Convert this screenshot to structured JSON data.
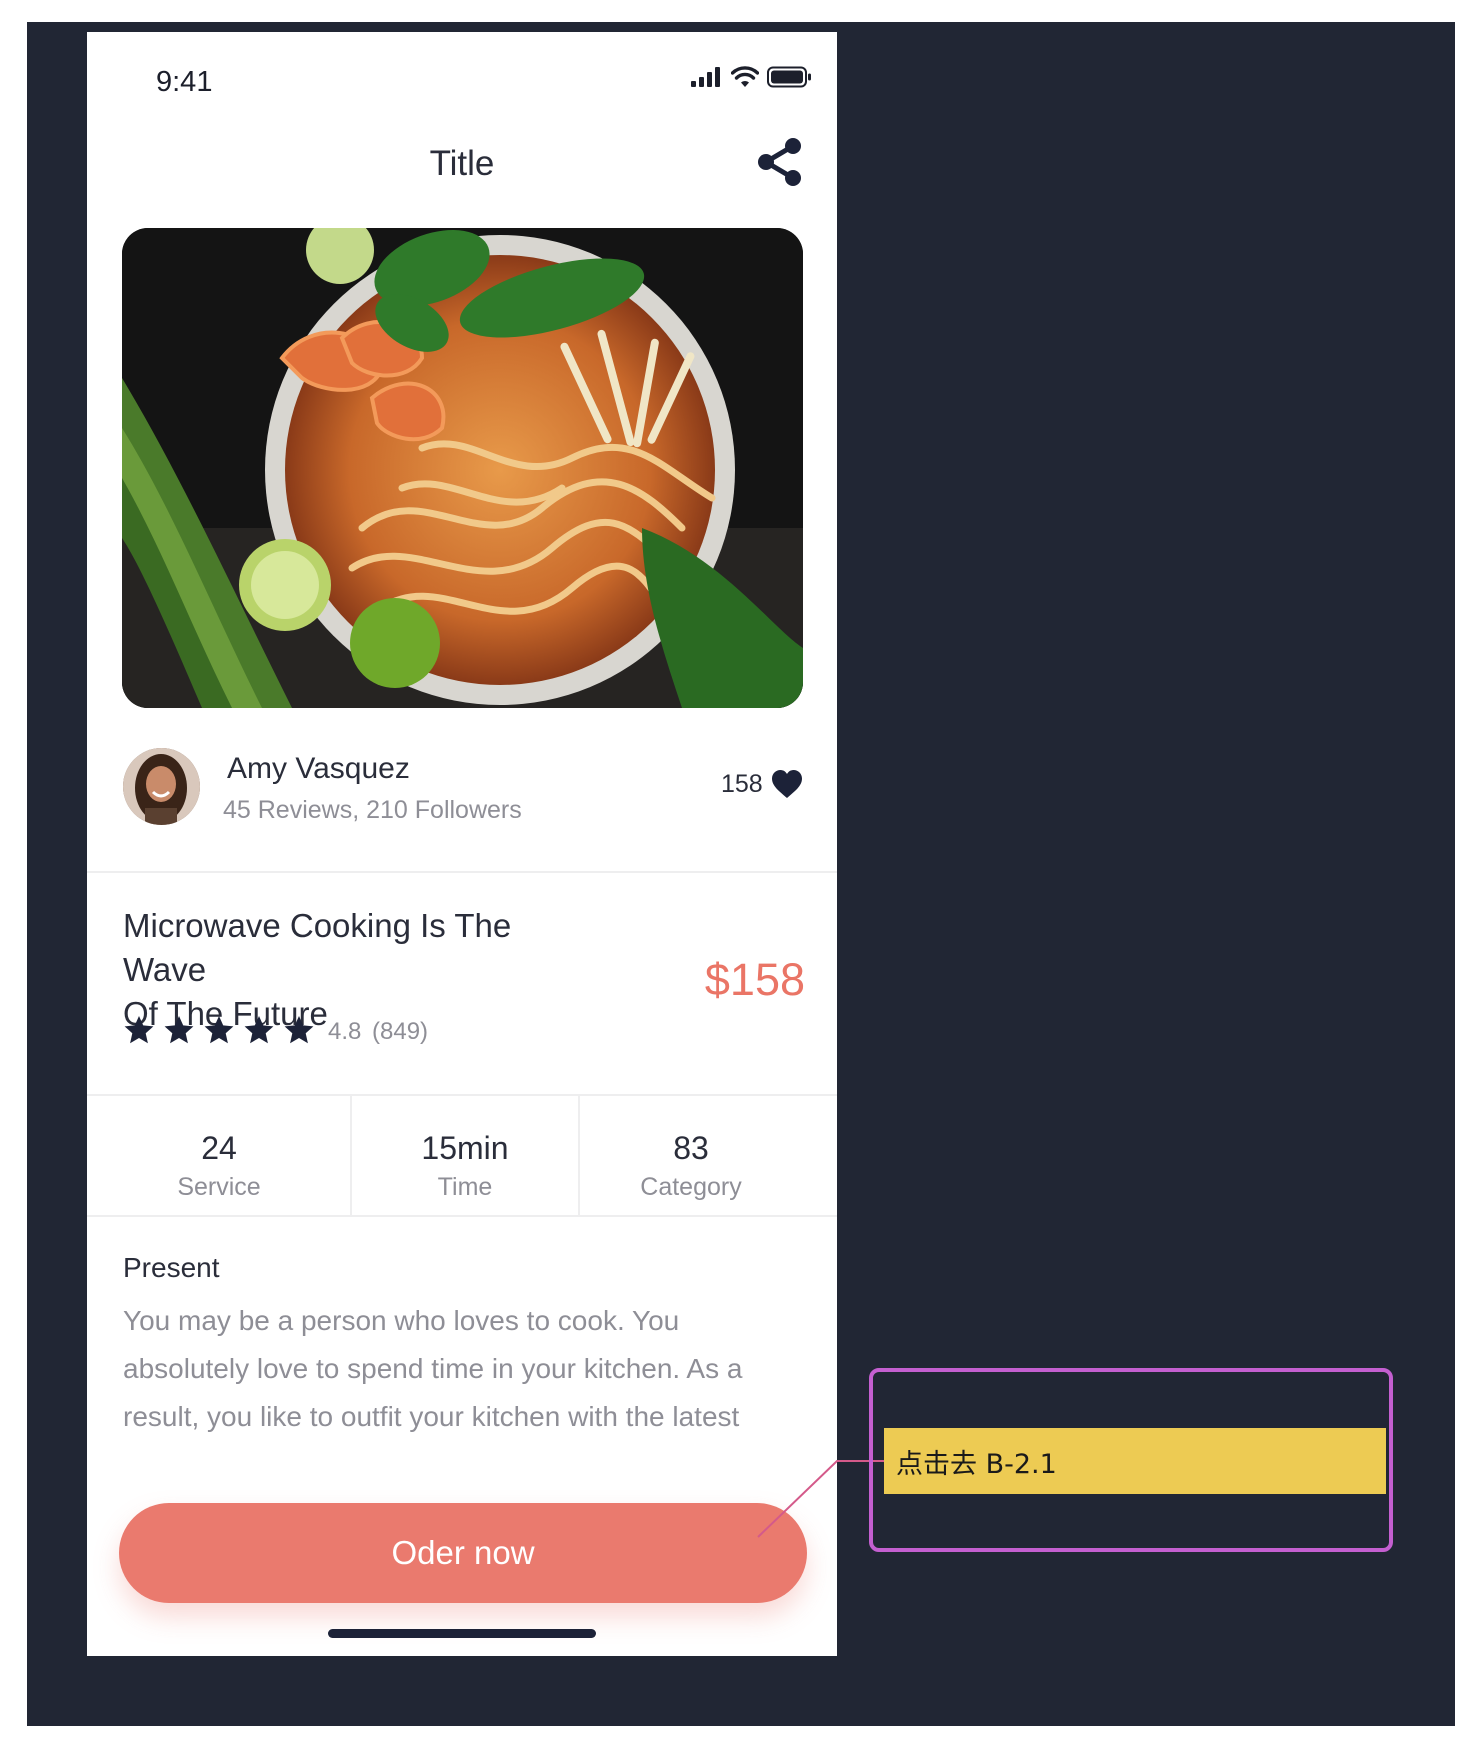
{
  "status_bar": {
    "time": "9:41"
  },
  "nav": {
    "title": "Title",
    "share_icon": "share-icon"
  },
  "hero": {
    "alt": "bowl of shrimp noodle soup"
  },
  "author": {
    "name": "Amy Vasquez",
    "stats": "45 Reviews, 210 Followers",
    "likes": "158",
    "like_icon": "heart-icon"
  },
  "recipe": {
    "title_line1": "Microwave Cooking Is The Wave",
    "title_line2": "Of The Future",
    "price": "$158",
    "stars": 5,
    "rating": "4.8",
    "rating_count": "(849)"
  },
  "stats": [
    {
      "value": "24",
      "label": "Service"
    },
    {
      "value": "15min",
      "label": "Time"
    },
    {
      "value": "83",
      "label": "Category"
    }
  ],
  "present": {
    "heading": "Present",
    "line1": "You may be a person who loves to cook. You",
    "line2": "absolutely love to spend time in your kitchen. As a",
    "line3": "result, you like to outfit your kitchen with the latest"
  },
  "order_button": {
    "label": "Oder now"
  },
  "annotation": {
    "label": "点击去 B-2.1"
  },
  "colors": {
    "background": "#212634",
    "accent": "#ea7a6e",
    "price": "#ea7566",
    "annotation_border": "#c45fd0",
    "annotation_fill": "#edcb53"
  }
}
